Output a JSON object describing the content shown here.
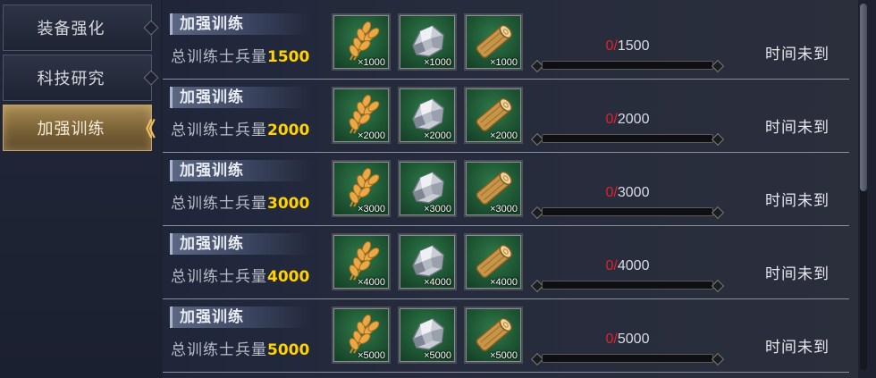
{
  "sidebar": {
    "tabs": [
      {
        "label": "装备强化",
        "active": false
      },
      {
        "label": "科技研究",
        "active": false
      },
      {
        "label": "加强训练",
        "active": true
      }
    ],
    "active_chevron": "《"
  },
  "icons": {
    "resources": [
      "wheat-icon",
      "ore-icon",
      "wood-log-icon"
    ]
  },
  "rows": [
    {
      "title": "加强训练",
      "req_label": "总训练士兵量",
      "req_value": "1500",
      "resources": [
        {
          "name": "wheat",
          "qty": "×1000"
        },
        {
          "name": "ore",
          "qty": "×1000"
        },
        {
          "name": "wood",
          "qty": "×1000"
        }
      ],
      "progress": {
        "current": "0",
        "separator": "/",
        "goal": "1500",
        "fraction": 0
      },
      "status": "时间未到"
    },
    {
      "title": "加强训练",
      "req_label": "总训练士兵量",
      "req_value": "2000",
      "resources": [
        {
          "name": "wheat",
          "qty": "×2000"
        },
        {
          "name": "ore",
          "qty": "×2000"
        },
        {
          "name": "wood",
          "qty": "×2000"
        }
      ],
      "progress": {
        "current": "0",
        "separator": "/",
        "goal": "2000",
        "fraction": 0
      },
      "status": "时间未到"
    },
    {
      "title": "加强训练",
      "req_label": "总训练士兵量",
      "req_value": "3000",
      "resources": [
        {
          "name": "wheat",
          "qty": "×3000"
        },
        {
          "name": "ore",
          "qty": "×3000"
        },
        {
          "name": "wood",
          "qty": "×3000"
        }
      ],
      "progress": {
        "current": "0",
        "separator": "/",
        "goal": "3000",
        "fraction": 0
      },
      "status": "时间未到"
    },
    {
      "title": "加强训练",
      "req_label": "总训练士兵量",
      "req_value": "4000",
      "resources": [
        {
          "name": "wheat",
          "qty": "×4000"
        },
        {
          "name": "ore",
          "qty": "×4000"
        },
        {
          "name": "wood",
          "qty": "×4000"
        }
      ],
      "progress": {
        "current": "0",
        "separator": "/",
        "goal": "4000",
        "fraction": 0
      },
      "status": "时间未到"
    },
    {
      "title": "加强训练",
      "req_label": "总训练士兵量",
      "req_value": "5000",
      "resources": [
        {
          "name": "wheat",
          "qty": "×5000"
        },
        {
          "name": "ore",
          "qty": "×5000"
        },
        {
          "name": "wood",
          "qty": "×5000"
        }
      ],
      "progress": {
        "current": "0",
        "separator": "/",
        "goal": "5000",
        "fraction": 0
      },
      "status": "时间未到"
    }
  ],
  "colors": {
    "accent_gold": "#ffd200",
    "progress_current": "#e0222c",
    "active_tab": "#a88a52"
  }
}
